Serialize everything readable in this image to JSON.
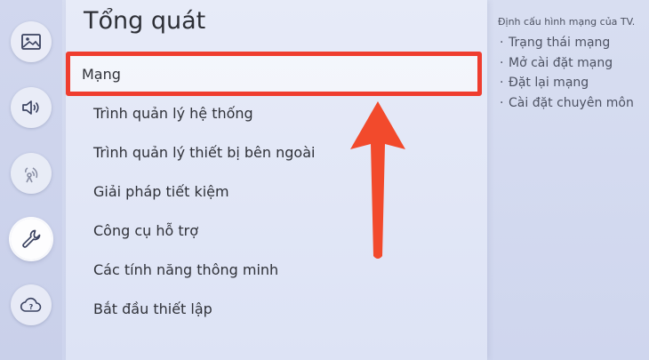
{
  "rail": {
    "items": [
      {
        "icon": "picture-icon"
      },
      {
        "icon": "sound-icon"
      },
      {
        "icon": "broadcast-icon"
      },
      {
        "icon": "wrench-icon",
        "selected": true
      },
      {
        "icon": "support-cloud-icon"
      }
    ]
  },
  "panel": {
    "title": "Tổng quát",
    "items": [
      {
        "label": "Mạng",
        "focused": true
      },
      {
        "label": "Trình quản lý hệ thống"
      },
      {
        "label": "Trình quản lý thiết bị bên ngoài"
      },
      {
        "label": "Giải pháp tiết kiệm"
      },
      {
        "label": "Công cụ hỗ trợ"
      },
      {
        "label": "Các tính năng thông minh"
      },
      {
        "label": "Bắt đầu thiết lập"
      }
    ]
  },
  "info": {
    "description": "Định cấu hình mạng của TV.",
    "items": [
      "Trạng thái mạng",
      "Mở cài đặt mạng",
      "Đặt lại mạng",
      "Cài đặt chuyên môn"
    ]
  },
  "colors": {
    "highlight": "#ef3d2f",
    "arrow": "#f24a2c"
  }
}
